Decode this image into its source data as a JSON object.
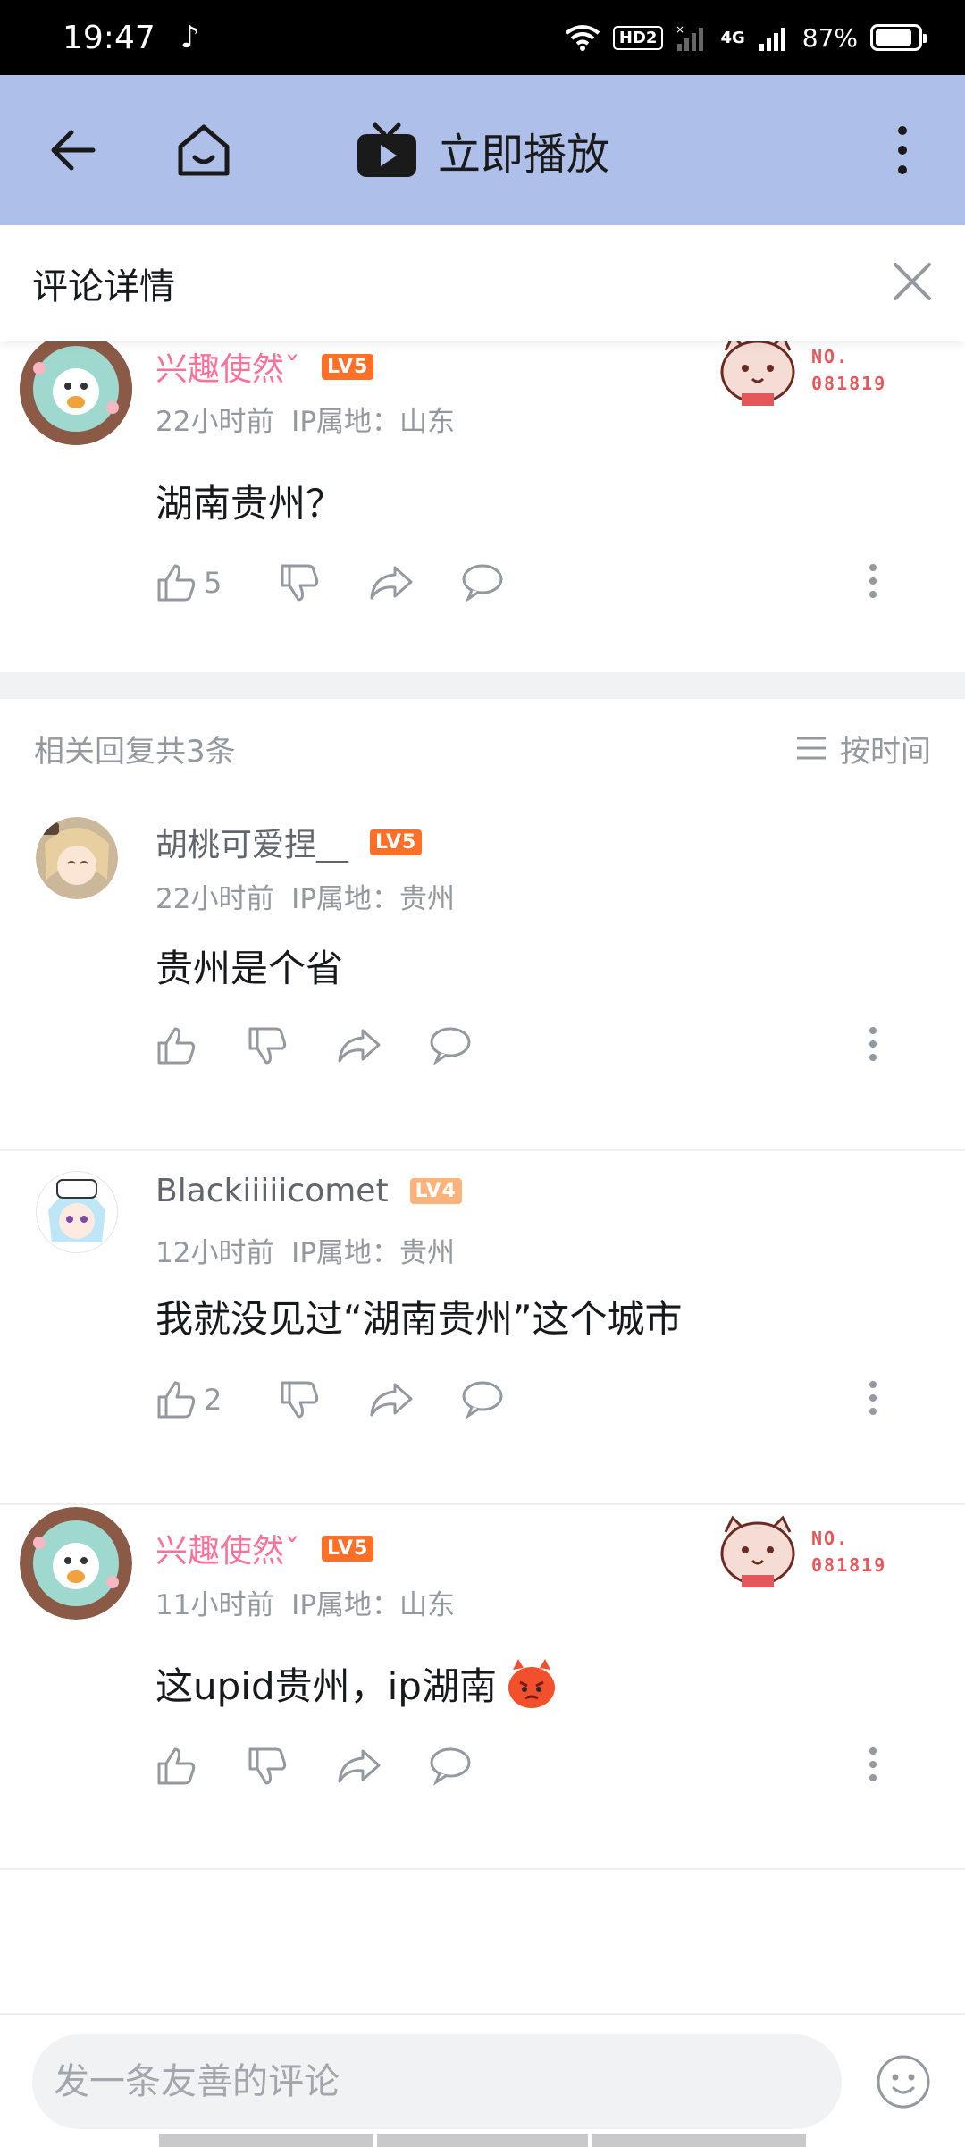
{
  "status_bar": {
    "time": "19:47",
    "hd_badge": "HD2",
    "network": "4G",
    "battery": "87%"
  },
  "toolbar": {
    "title": "立即播放"
  },
  "detail": {
    "title": "评论详情"
  },
  "root_comment": {
    "username": "兴趣使然ˇ",
    "level": "LV5",
    "time": "22小时前",
    "ip": "IP属地：山东",
    "text": "湖南贵州？",
    "likes": "5",
    "badge_no": "NO.",
    "badge_num": "081819"
  },
  "replies_header": {
    "count_text": "相关回复共3条",
    "sort_label": "按时间"
  },
  "replies": [
    {
      "username": "胡桃可爱捏__",
      "level": "LV5",
      "time": "22小时前",
      "ip": "IP属地：贵州",
      "text": "贵州是个省",
      "likes": ""
    },
    {
      "username": "Blackiiiiicomet",
      "level": "LV4",
      "time": "12小时前",
      "ip": "IP属地：贵州",
      "text": "我就没见过“湖南贵州”这个城市",
      "likes": "2"
    },
    {
      "username": "兴趣使然ˇ",
      "level": "LV5",
      "time": "11小时前",
      "ip": "IP属地：山东",
      "text": "这upid贵州，ip湖南",
      "likes": "",
      "badge_no": "NO.",
      "badge_num": "081819"
    }
  ],
  "input": {
    "placeholder": "发一条友善的评论"
  },
  "colors": {
    "accent_pink": "#fb7299",
    "toolbar_bg": "#aec0ea",
    "level5": "#ff6f25",
    "level4": "#ffb27a",
    "meta_gray": "#9499a0"
  }
}
